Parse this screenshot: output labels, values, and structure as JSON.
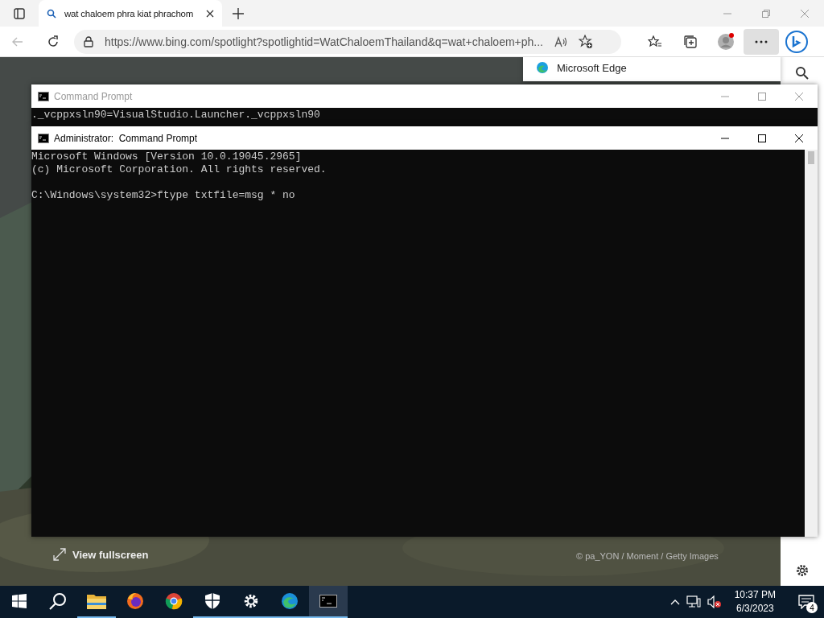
{
  "browser": {
    "tab": {
      "title": "wat chaloem phra kiat phrachom"
    },
    "address": "https://www.bing.com/spotlight?spotlightid=WatChaloemThailand&q=wat+chaloem+ph...",
    "popup": {
      "title": "Microsoft Edge"
    }
  },
  "page": {
    "view_fullscreen": "View fullscreen",
    "credit": "© pa_YON / Moment / Getty Images"
  },
  "windows": [
    {
      "title": "Command Prompt",
      "active": false,
      "lines": [
        "._vcppxsln90=VisualStudio.Launcher._vcppxsln90"
      ]
    },
    {
      "title": "Administrator:  Command Prompt",
      "active": true,
      "lines": [
        "Microsoft Windows [Version 10.0.19045.2965]",
        "(c) Microsoft Corporation. All rights reserved."
      ],
      "prompt": "C:\\Windows\\system32>ftype txtfile=msg * no"
    }
  ],
  "taskbar": {
    "apps": [
      {
        "kind": "explorer",
        "running": true,
        "selected": false
      },
      {
        "kind": "firefox",
        "running": false,
        "selected": false
      },
      {
        "kind": "chrome",
        "running": false,
        "selected": false
      },
      {
        "kind": "security",
        "running": true,
        "selected": false
      },
      {
        "kind": "settings",
        "running": true,
        "selected": false
      },
      {
        "kind": "edge",
        "running": true,
        "selected": false
      },
      {
        "kind": "terminal",
        "running": true,
        "selected": true
      }
    ],
    "time": "10:37 PM",
    "date": "6/3/2023",
    "notifications": "4"
  }
}
